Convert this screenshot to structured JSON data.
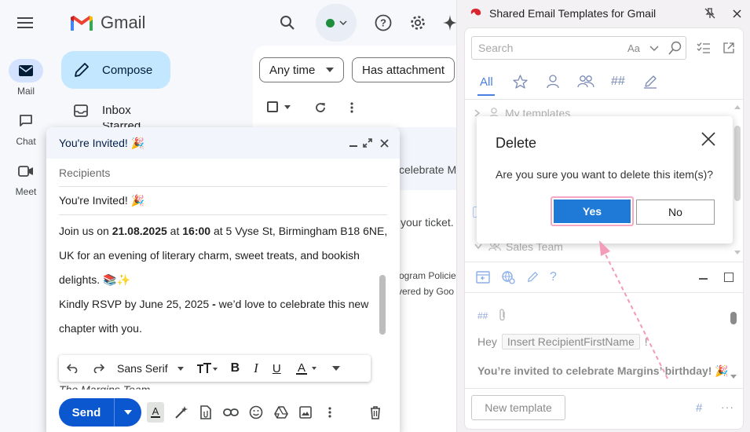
{
  "gmail": {
    "logo_text": "Gmail",
    "rail": [
      {
        "label": "Mail"
      },
      {
        "label": "Chat"
      },
      {
        "label": "Meet"
      }
    ],
    "compose_label": "Compose",
    "nav": [
      {
        "label": "Inbox"
      },
      {
        "label": "Starred"
      }
    ],
    "filters": {
      "any_time": "Any time",
      "has_attachment": "Has attachment"
    },
    "rows": {
      "snippet1": "celebrate M",
      "snippet2": "your ticket.",
      "footer1": "ogram Policie",
      "footer2": "vered by Goo"
    }
  },
  "compose": {
    "title": "You're Invited! 🎉",
    "recipients_placeholder": "Recipients",
    "subject": "You're Invited! 🎉",
    "body": {
      "line1_pre": "Join us on ",
      "line1_date": "21.08.2025",
      "line1_mid": " at ",
      "line1_time": "16:00",
      "line1_post": " at  5 Vyse St, Birmingham B18 6NE,",
      "line2": "UK for an evening of literary charm, sweet treats, and bookish",
      "line3": "delights. 📚✨",
      "line4_pre": "Kindly RSVP by June 25, 2025 ",
      "line4_dash": "-",
      "line4_post": " we’d love to celebrate this new",
      "line5": "chapter with you.",
      "sig": "The Margins Team"
    },
    "font_name": "Sans Serif",
    "send_label": "Send"
  },
  "panel": {
    "title": "Shared Email Templates for Gmail",
    "search_placeholder": "Search",
    "case_toggle": "Aa",
    "tab_all": "All",
    "hash_tab": "##",
    "folder_my": "My templates",
    "folder_sales": "Sales Team",
    "editor_hash": "##",
    "editor_hey": "Hey",
    "editor_field": "Insert RecipientFirstName",
    "editor_bang": "!",
    "editor_headline": "You’re invited to celebrate Margins’ birthday! 🎉",
    "new_template_label": "New template",
    "more": "···"
  },
  "dialog": {
    "title": "Delete",
    "message": "Are you sure you want to delete this item(s)?",
    "yes": "Yes",
    "no": "No"
  },
  "colors": {
    "accent_blue": "#0b57d0",
    "yes_blue": "#1e7ad6",
    "highlight_pink": "#f5a8c4",
    "compose_chip": "#c2e7ff"
  }
}
